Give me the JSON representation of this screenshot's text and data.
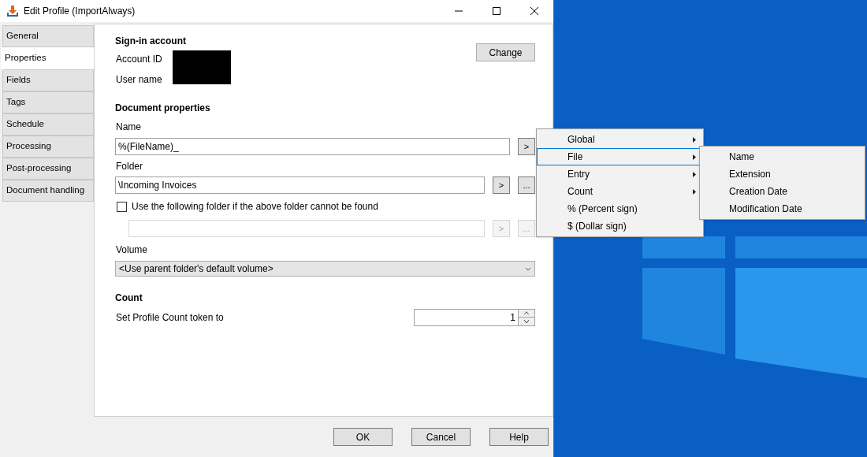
{
  "window": {
    "title": "Edit Profile (ImportAlways)"
  },
  "tabs": [
    {
      "label": "General",
      "selected": false
    },
    {
      "label": "Properties",
      "selected": true
    },
    {
      "label": "Fields",
      "selected": false
    },
    {
      "label": "Tags",
      "selected": false
    },
    {
      "label": "Schedule",
      "selected": false
    },
    {
      "label": "Processing",
      "selected": false
    },
    {
      "label": "Post-processing",
      "selected": false
    },
    {
      "label": "Document handling",
      "selected": false
    }
  ],
  "sign_in": {
    "heading": "Sign-in account",
    "account_id_label": "Account ID",
    "user_name_label": "User name",
    "change_button": "Change"
  },
  "document_properties": {
    "heading": "Document properties",
    "name_label": "Name",
    "name_value": "%(FileName)_",
    "insert_button": ">",
    "folder_label": "Folder",
    "folder_value": "\\Incoming Invoices",
    "folder_insert_button": ">",
    "folder_browse_button": "...",
    "fallback": {
      "label": "Use the following folder if the above folder cannot be found",
      "checked": false,
      "insert_button": ">",
      "browse_button": "..."
    },
    "volume_label": "Volume",
    "volume_value": "<Use parent folder's default volume>"
  },
  "count": {
    "heading": "Count",
    "label": "Set Profile Count token to",
    "value": "1"
  },
  "buttons": [
    "OK",
    "Cancel",
    "Help"
  ],
  "context_menu": [
    {
      "label": "Global",
      "submenu": true,
      "selected": false
    },
    {
      "label": "File",
      "submenu": true,
      "selected": true
    },
    {
      "label": "Entry",
      "submenu": true,
      "selected": false
    },
    {
      "label": "Count",
      "submenu": true,
      "selected": false
    },
    {
      "label": "% (Percent sign)",
      "submenu": false,
      "selected": false
    },
    {
      "label": "$ (Dollar sign)",
      "submenu": false,
      "selected": false
    }
  ],
  "submenu": [
    "Name",
    "Extension",
    "Creation Date",
    "Modification Date"
  ]
}
